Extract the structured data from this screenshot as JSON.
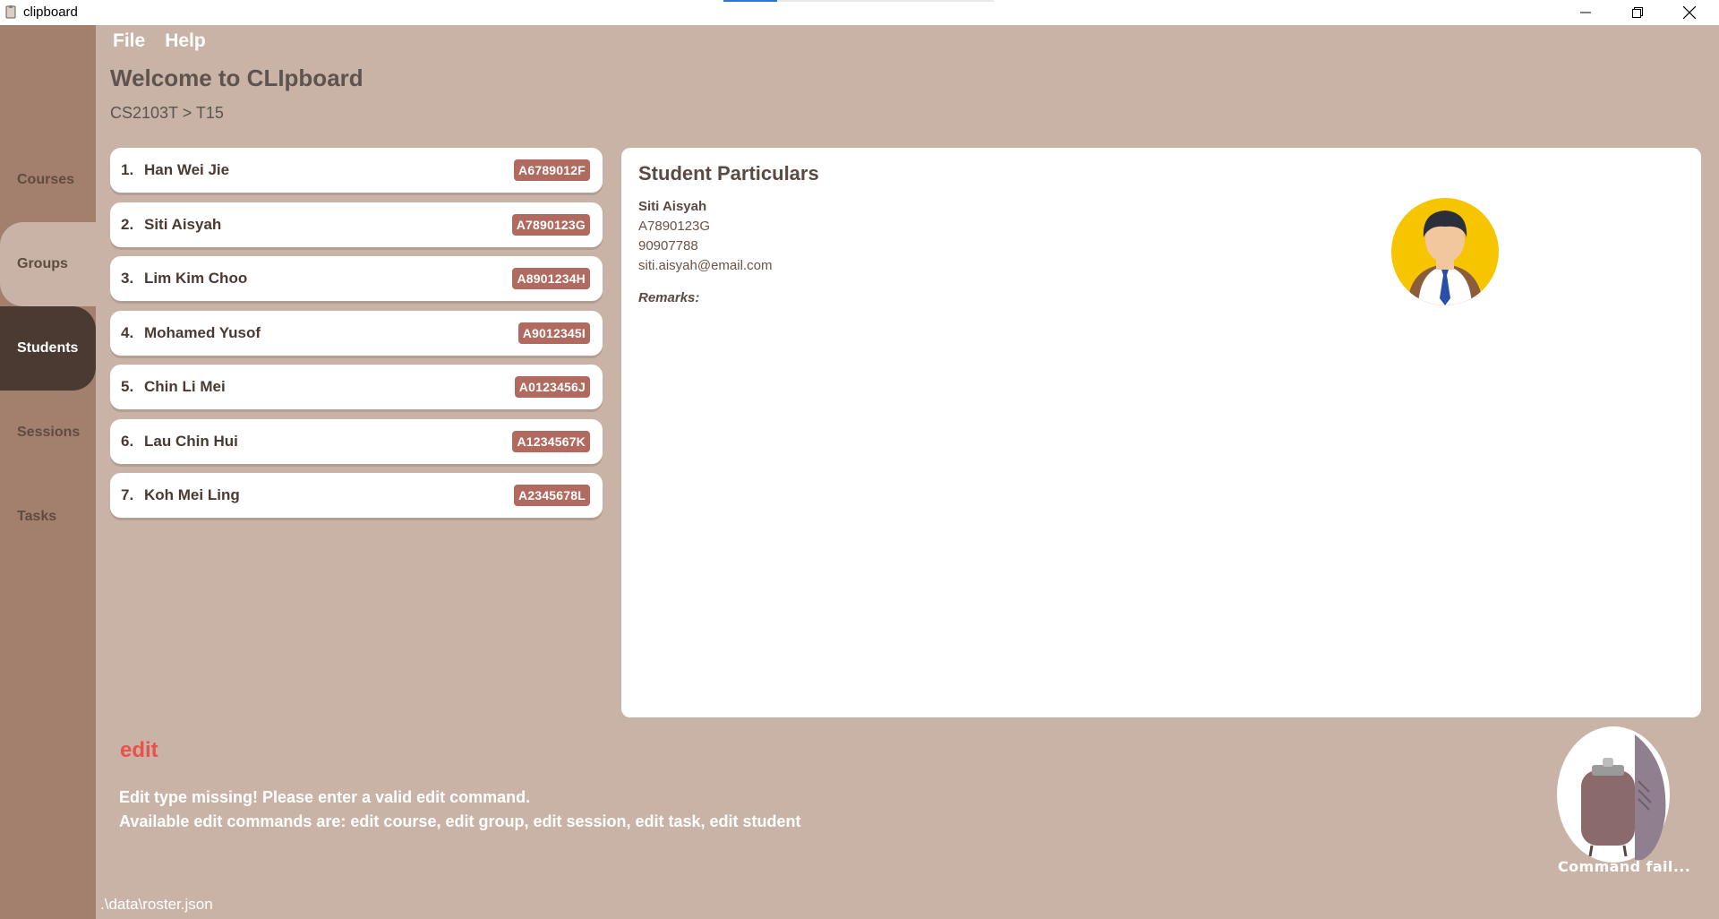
{
  "window": {
    "title": "clipboard"
  },
  "menu": {
    "file": "File",
    "help": "Help"
  },
  "header": {
    "welcome": "Welcome to CLIpboard",
    "breadcrumb": "CS2103T > T15"
  },
  "sidebar": {
    "items": [
      {
        "label": "Courses"
      },
      {
        "label": "Groups"
      },
      {
        "label": "Students"
      },
      {
        "label": "Sessions"
      },
      {
        "label": "Tasks"
      }
    ],
    "active": "Students"
  },
  "students": [
    {
      "index": "1.",
      "name": "Han Wei Jie",
      "id": "A6789012F"
    },
    {
      "index": "2.",
      "name": "Siti Aisyah",
      "id": "A7890123G"
    },
    {
      "index": "3.",
      "name": "Lim Kim Choo",
      "id": "A8901234H"
    },
    {
      "index": "4.",
      "name": "Mohamed Yusof",
      "id": "A9012345I"
    },
    {
      "index": "5.",
      "name": "Chin Li Mei",
      "id": "A0123456J"
    },
    {
      "index": "6.",
      "name": "Lau Chin Hui",
      "id": "A1234567K"
    },
    {
      "index": "7.",
      "name": "Koh Mei Ling",
      "id": "A2345678L"
    }
  ],
  "particulars": {
    "title": "Student Particulars",
    "name": "Siti Aisyah",
    "id": "A7890123G",
    "phone": "90907788",
    "email": "siti.aisyah@email.com",
    "remarks_label": "Remarks:"
  },
  "command": {
    "input": "edit",
    "result_line1": "Edit type missing! Please enter a valid edit command.",
    "result_line2": "Available edit commands are: edit course, edit group, edit session, edit task, edit student"
  },
  "mascot": {
    "caption": "Command fail..."
  },
  "status": {
    "path": ".\\data\\roster.json"
  },
  "colors": {
    "background": "#c9b3a7",
    "sidebar": "#a3806d",
    "active_nav": "#4a3a32",
    "badge": "#b06a5f",
    "error": "#e8524a"
  }
}
